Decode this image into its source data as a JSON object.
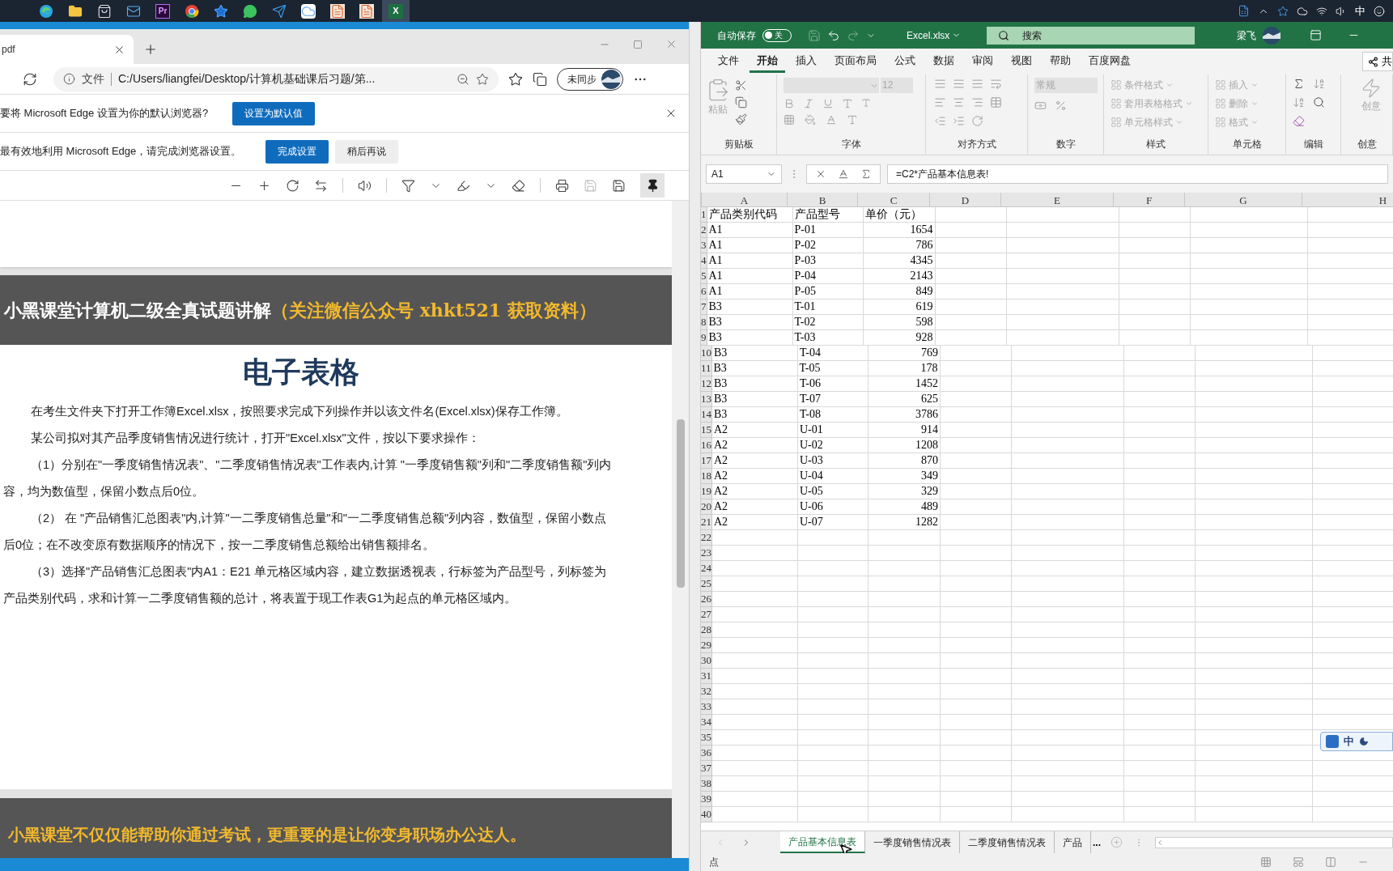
{
  "taskbar": {
    "apps": [
      {
        "kind": "browser",
        "selected": false
      },
      {
        "kind": "folder",
        "selected": false
      },
      {
        "kind": "store",
        "selected": false
      },
      {
        "kind": "mail",
        "selected": false
      },
      {
        "kind": "premiere",
        "label": "Pr",
        "selected": false
      },
      {
        "kind": "chrome",
        "selected": false
      },
      {
        "kind": "star",
        "selected": false
      },
      {
        "kind": "chat",
        "selected": false
      },
      {
        "kind": "send",
        "selected": false
      },
      {
        "kind": "cloud",
        "selected": false
      },
      {
        "kind": "document",
        "selected": false
      },
      {
        "kind": "document",
        "selected": false
      },
      {
        "kind": "excel",
        "label": "X",
        "selected": true
      }
    ],
    "tray": {
      "ime": "中"
    }
  },
  "browser": {
    "tab": {
      "title": "pdf"
    },
    "address": {
      "scheme": "文件",
      "url": "C:/Users/liangfei/Desktop/计算机基础课后习题/第..."
    },
    "profile": "未同步",
    "infobars": [
      {
        "message": "要将 Microsoft Edge 设置为你的默认浏览器?",
        "closable": true,
        "buttons": [
          {
            "label": "设置为默认值",
            "primary": true
          }
        ]
      },
      {
        "message": "最有效地利用 Microsoft Edge，请完成浏览器设置。",
        "closable": false,
        "buttons": [
          {
            "label": "完成设置",
            "primary": true
          },
          {
            "label": "稍后再说",
            "primary": false
          }
        ]
      }
    ],
    "pdf": {
      "banner": "小黑课堂计算机二级全真试题讲解",
      "banner_accent": "（关注微信公众号 xhkt521 获取资料）",
      "heading": "电子表格",
      "paragraphs": [
        "在考生文件夹下打开工作簿Excel.xlsx，按照要求完成下列操作并以该文件名(Excel.xlsx)保存工作簿。",
        "某公司拟对其产品季度销售情况进行统计，打开\"Excel.xlsx\"文件，按以下要求操作：",
        "（1）分别在\"一季度销售情况表\"、\"二季度销售情况表\"工作表内,计算 \"一季度销售额\"列和\"二季度销售额\"列内容，均为数值型，保留小数点后0位。",
        "（2） 在 \"产品销售汇总图表\"内,计算\"一二季度销售总量\"和\"一二季度销售总额\"列内容，数值型，保留小数点后0位；在不改变原有数据顺序的情况下，按一二季度销售总额给出销售额排名。",
        "（3）选择\"产品销售汇总图表\"内A1：E21 单元格区域内容，建立数据透视表，行标签为产品型号，列标签为产品类别代码，求和计算一二季度销售额的总计，将表置于现工作表G1为起点的单元格区域内。"
      ],
      "footer_banner": "小黑课堂不仅仅能帮助你通过考试，更重要的是让你变身职场办公达人。"
    }
  },
  "excel": {
    "autosave": {
      "label": "自动保存",
      "on": false,
      "state_label": "关"
    },
    "filename": "Excel.xlsx",
    "search": "搜索",
    "user": "梁飞",
    "tabs": [
      {
        "label": "文件",
        "selected": false
      },
      {
        "label": "开始",
        "selected": true
      },
      {
        "label": "插入",
        "selected": false
      },
      {
        "label": "页面布局",
        "selected": false
      },
      {
        "label": "公式",
        "selected": false
      },
      {
        "label": "数据",
        "selected": false
      },
      {
        "label": "审阅",
        "selected": false
      },
      {
        "label": "视图",
        "selected": false
      },
      {
        "label": "帮助",
        "selected": false
      },
      {
        "label": "百度网盘",
        "selected": false
      }
    ],
    "share": "共",
    "groups": [
      {
        "kind": "clipboard",
        "label": "剪贴板",
        "commands": [
          {
            "label": "粘贴",
            "disabled": true
          }
        ]
      },
      {
        "kind": "font",
        "label": "字体",
        "commands": [
          {
            "label": "12",
            "disabled": true
          }
        ]
      },
      {
        "kind": "alignment",
        "label": "对齐方式"
      },
      {
        "kind": "number",
        "label": "数字",
        "commands": [
          {
            "label": "常规",
            "disabled": true
          }
        ]
      },
      {
        "kind": "styles",
        "label": "样式",
        "commands": [
          {
            "label": "条件格式",
            "disabled": true
          },
          {
            "label": "套用表格格式",
            "disabled": true
          },
          {
            "label": "单元格样式",
            "disabled": true
          }
        ]
      },
      {
        "kind": "cells",
        "label": "单元格",
        "commands": [
          {
            "label": "插入",
            "disabled": true
          },
          {
            "label": "删除",
            "disabled": true
          },
          {
            "label": "格式",
            "disabled": true
          }
        ]
      },
      {
        "kind": "editing",
        "label": "编辑"
      },
      {
        "kind": "ideas",
        "label": "创意",
        "commands": [
          {
            "label": "创意",
            "disabled": true
          }
        ]
      }
    ],
    "name_box": "A1",
    "formula": "=C2*产品基本信息表!",
    "columns": [
      {
        "label": "A",
        "kind": "text"
      },
      {
        "label": "B",
        "kind": "text"
      },
      {
        "label": "C",
        "kind": "number"
      },
      {
        "label": "D",
        "kind": "text"
      },
      {
        "label": "E",
        "kind": "text"
      },
      {
        "label": "F",
        "kind": "text"
      },
      {
        "label": "G",
        "kind": "text"
      },
      {
        "label": "H",
        "kind": "text"
      }
    ],
    "rows": [
      {
        "number": "1",
        "kind": "header",
        "cells": [
          "产品类别代码",
          "产品型号",
          "单价（元）"
        ]
      },
      {
        "number": "2",
        "kind": "data",
        "cells": [
          "A1",
          "P-01",
          "1654"
        ]
      },
      {
        "number": "3",
        "kind": "data",
        "cells": [
          "A1",
          "P-02",
          "786"
        ]
      },
      {
        "number": "4",
        "kind": "data",
        "cells": [
          "A1",
          "P-03",
          "4345"
        ]
      },
      {
        "number": "5",
        "kind": "data",
        "cells": [
          "A1",
          "P-04",
          "2143"
        ]
      },
      {
        "number": "6",
        "kind": "data",
        "cells": [
          "A1",
          "P-05",
          "849"
        ]
      },
      {
        "number": "7",
        "kind": "data",
        "cells": [
          "B3",
          "T-01",
          "619"
        ]
      },
      {
        "number": "8",
        "kind": "data",
        "cells": [
          "B3",
          "T-02",
          "598"
        ]
      },
      {
        "number": "9",
        "kind": "data",
        "cells": [
          "B3",
          "T-03",
          "928"
        ]
      },
      {
        "number": "10",
        "kind": "data",
        "cells": [
          "B3",
          "T-04",
          "769"
        ]
      },
      {
        "number": "11",
        "kind": "data",
        "cells": [
          "B3",
          "T-05",
          "178"
        ]
      },
      {
        "number": "12",
        "kind": "data",
        "cells": [
          "B3",
          "T-06",
          "1452"
        ]
      },
      {
        "number": "13",
        "kind": "data",
        "cells": [
          "B3",
          "T-07",
          "625"
        ]
      },
      {
        "number": "14",
        "kind": "data",
        "cells": [
          "B3",
          "T-08",
          "3786"
        ]
      },
      {
        "number": "15",
        "kind": "data",
        "cells": [
          "A2",
          "U-01",
          "914"
        ]
      },
      {
        "number": "16",
        "kind": "data",
        "cells": [
          "A2",
          "U-02",
          "1208"
        ]
      },
      {
        "number": "17",
        "kind": "data",
        "cells": [
          "A2",
          "U-03",
          "870"
        ]
      },
      {
        "number": "18",
        "kind": "data",
        "cells": [
          "A2",
          "U-04",
          "349"
        ]
      },
      {
        "number": "19",
        "kind": "data",
        "cells": [
          "A2",
          "U-05",
          "329"
        ]
      },
      {
        "number": "20",
        "kind": "data",
        "cells": [
          "A2",
          "U-06",
          "489"
        ]
      },
      {
        "number": "21",
        "kind": "data",
        "cells": [
          "A2",
          "U-07",
          "1282"
        ]
      },
      {
        "number": "22"
      },
      {
        "number": "23"
      },
      {
        "number": "24"
      },
      {
        "number": "25"
      },
      {
        "number": "26"
      },
      {
        "number": "27"
      },
      {
        "number": "28"
      },
      {
        "number": "29"
      },
      {
        "number": "30"
      },
      {
        "number": "31"
      },
      {
        "number": "32"
      },
      {
        "number": "33"
      },
      {
        "number": "34"
      },
      {
        "number": "35"
      },
      {
        "number": "36"
      },
      {
        "number": "37"
      },
      {
        "number": "38"
      },
      {
        "number": "39"
      },
      {
        "number": "40"
      }
    ],
    "sheets": [
      {
        "label": "产品基本信息表",
        "selected": true
      },
      {
        "label": "一季度销售情况表",
        "selected": false
      },
      {
        "label": "二季度销售情况表",
        "selected": false
      },
      {
        "label": "产品",
        "selected": false
      }
    ],
    "sheets_more": "...",
    "ime": "中",
    "status": "点"
  }
}
